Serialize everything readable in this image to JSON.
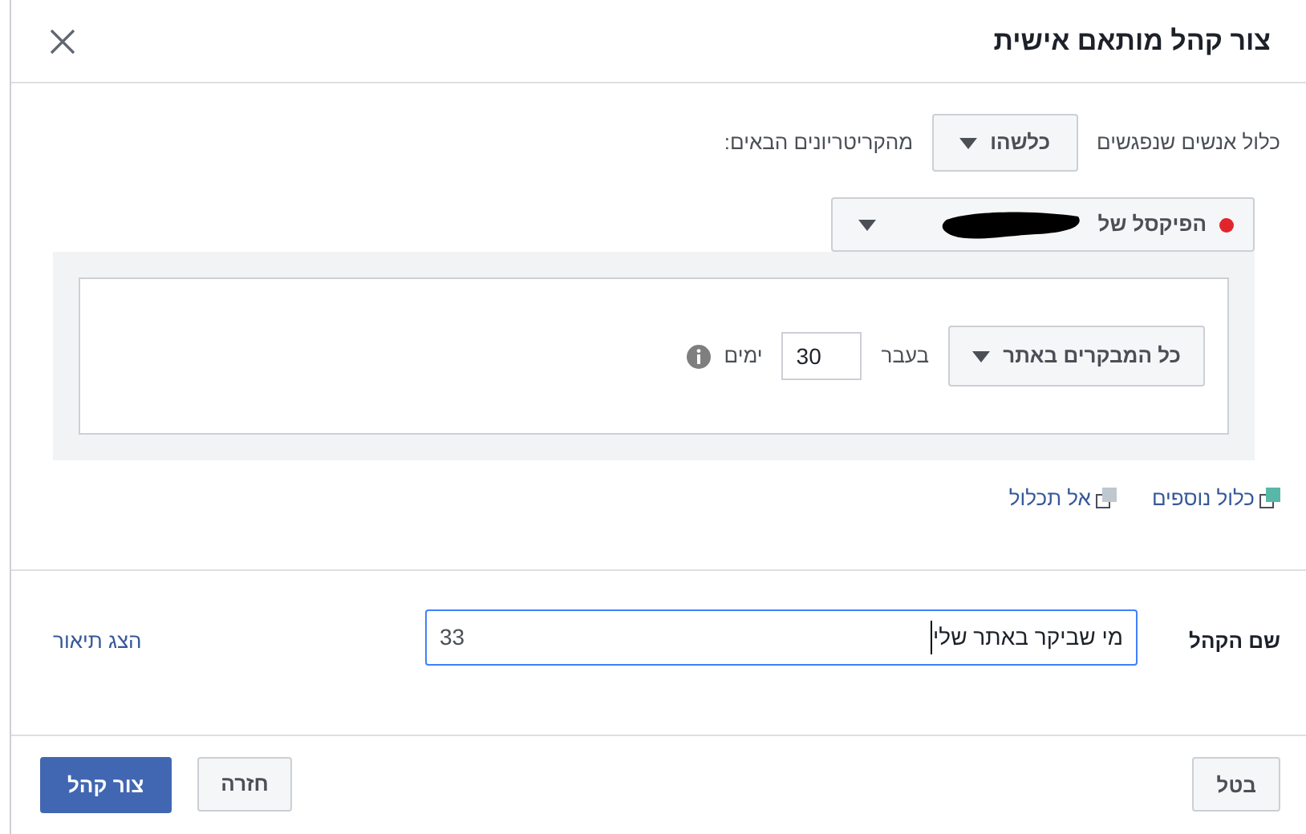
{
  "dialog": {
    "title": "צור קהל מותאם אישית"
  },
  "rule": {
    "prefix": "כלול אנשים שנפגשים",
    "match": "כלשהו",
    "suffix": "מהקריטריונים הבאים:"
  },
  "source": {
    "label": "הפיקסל של"
  },
  "criterion": {
    "event": "כל המבקרים באתר",
    "in_last": "בעבר",
    "days": "30",
    "unit": "ימים"
  },
  "links": [
    {
      "label": "כלול נוספים",
      "kind": "include"
    },
    {
      "label": "אל תכלול",
      "kind": "exclude"
    }
  ],
  "name_field": {
    "label": "שם הקהל",
    "value": "מי שביקר באתר שלי",
    "counter": "33",
    "description_link": "הצג תיאור"
  },
  "footer": {
    "cancel": "בטל",
    "back": "חזרה",
    "create": "צור קהל"
  }
}
